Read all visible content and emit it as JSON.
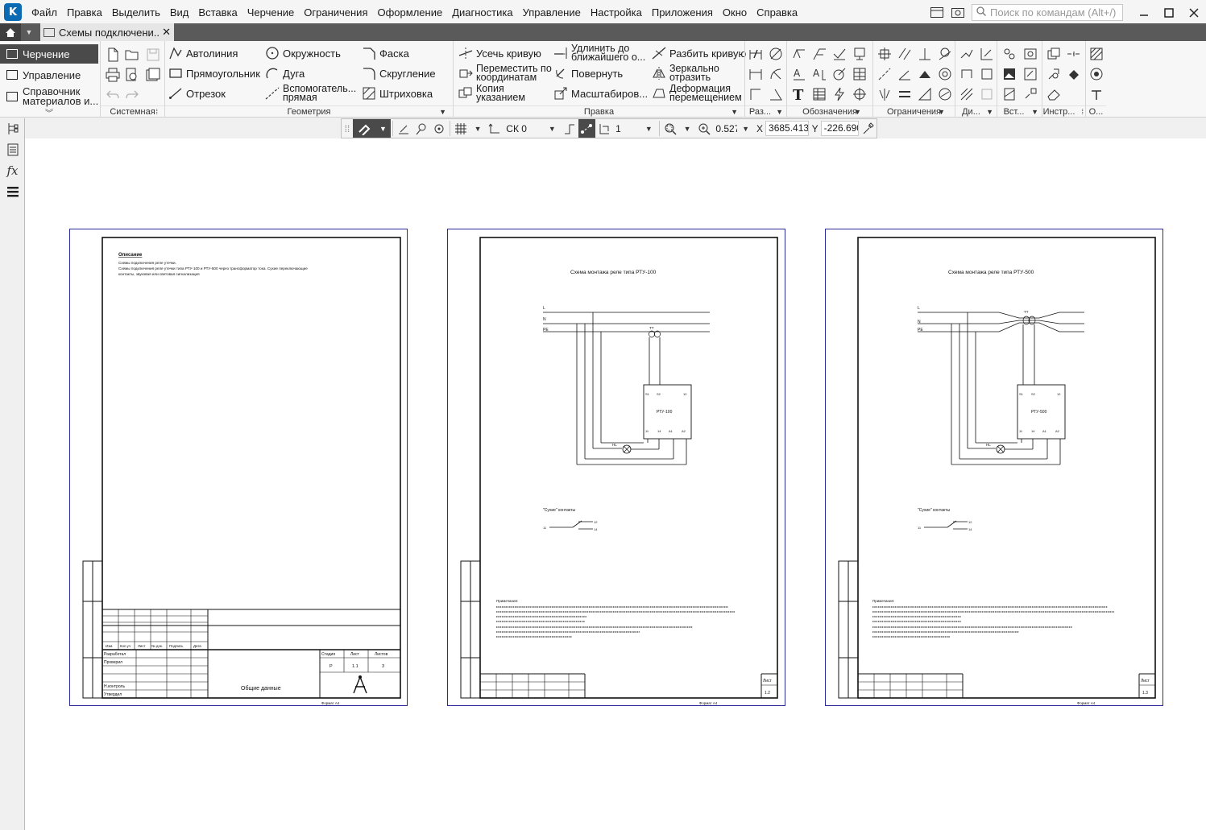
{
  "menubar": {
    "items": [
      "Файл",
      "Правка",
      "Выделить",
      "Вид",
      "Вставка",
      "Черчение",
      "Ограничения",
      "Оформление",
      "Диагностика",
      "Управление",
      "Настройка",
      "Приложения",
      "Окно",
      "Справка"
    ],
    "search_placeholder": "Поиск по командам (Alt+/)"
  },
  "tabs": {
    "document_title": "Схемы подключени..."
  },
  "ribbon": {
    "modes": {
      "drawing": "Черчение",
      "management": "Управление",
      "reference_l1": "Справочник",
      "reference_l2": "материалов и..."
    },
    "groups": {
      "system": "Системная",
      "geometry": "Геометрия",
      "edit": "Правка",
      "size": "Раз...",
      "notation": "Обозначения",
      "constraints": "Ограничения",
      "di": "Ди...",
      "insert": "Вст...",
      "instr": "Инстр...",
      "o": "О..."
    },
    "geometry": {
      "autoline": "Автолиния",
      "circle": "Окружность",
      "chamfer": "Фаска",
      "rectangle": "Прямоугольник",
      "arc": "Дуга",
      "fillet": "Скругление",
      "segment": "Отрезок",
      "aux_line_l1": "Вспомогатель...",
      "aux_line_l2": "прямая",
      "hatch": "Штриховка"
    },
    "edit": {
      "trim": "Усечь кривую",
      "extend_l1": "Удлинить до",
      "extend_l2": "ближайшего о...",
      "split": "Разбить кривую",
      "move_l1": "Переместить по",
      "move_l2": "координатам",
      "rotate": "Повернуть",
      "mirror_l1": "Зеркально",
      "mirror_l2": "отразить",
      "copy_l1": "Копия",
      "copy_l2": "указанием",
      "scale": "Масштабиров...",
      "deform_l1": "Деформация",
      "deform_l2": "перемещением"
    }
  },
  "drawtoolbar": {
    "cs": "СК 0",
    "layer": "1",
    "zoom": "0.527",
    "x_label": "X",
    "x_value": "3685.413",
    "y_label": "Y",
    "y_value": "-226.690"
  },
  "sheets": {
    "sheet1": {
      "heading": "Описание",
      "line1": "Схемы подключения реле утечки.",
      "line2": "Схемы подключения реле утечки типа РТУ-100 и РТУ-500 через трансформатор тока. Сухие переключающие",
      "line3": "контакты, звуковая или световая сигнализация",
      "title": "Общие данные",
      "stage_h": "Стадия",
      "sheet_h": "Лист",
      "sheets_h": "Листов",
      "stage_v": "Р",
      "sheet_v": "1.1",
      "sheets_v": "3",
      "developed": "Разработал",
      "checked": "Проверил",
      "normcontrol": "Н.контроль",
      "approved": "Утвердил",
      "col_izm": "Изм.",
      "col_kol": "Кол.уч",
      "col_list": "Лист",
      "col_doc": "№ док.",
      "col_sign": "Подпись",
      "col_date": "Дата",
      "format": "Формат А4"
    },
    "sheet2": {
      "title": "Схема монтажа реле типа РТУ-100",
      "device": "РТУ-100",
      "tt": "ТТ",
      "dry": "\"Сухие\" контакты",
      "notes_h": "Примечания:",
      "list_label": "Лист",
      "list_no": "1.2",
      "format": "Формат А4"
    },
    "sheet3": {
      "title": "Схема монтажа реле типа РТУ-500",
      "device": "РТУ-500",
      "tt": "ТТ",
      "dry": "\"Сухие\" контакты",
      "notes_h": "Примечания:",
      "list_label": "Лист",
      "list_no": "1.3",
      "format": "Формат А4"
    },
    "wires": {
      "l": "L",
      "n": "N",
      "pe": "PE",
      "hl": "HL",
      "s1": "S1",
      "s2": "S2",
      "t12": "12",
      "t11": "11",
      "t14": "14",
      "a1": "A1",
      "a2": "A2",
      "c11": "11",
      "c12": "12",
      "c14": "14"
    }
  },
  "colors": {
    "sheet_border": "#2a2a9a",
    "ink": "#111111",
    "active_mode": "#4a4a4a",
    "logo": "#0a6ab3"
  }
}
